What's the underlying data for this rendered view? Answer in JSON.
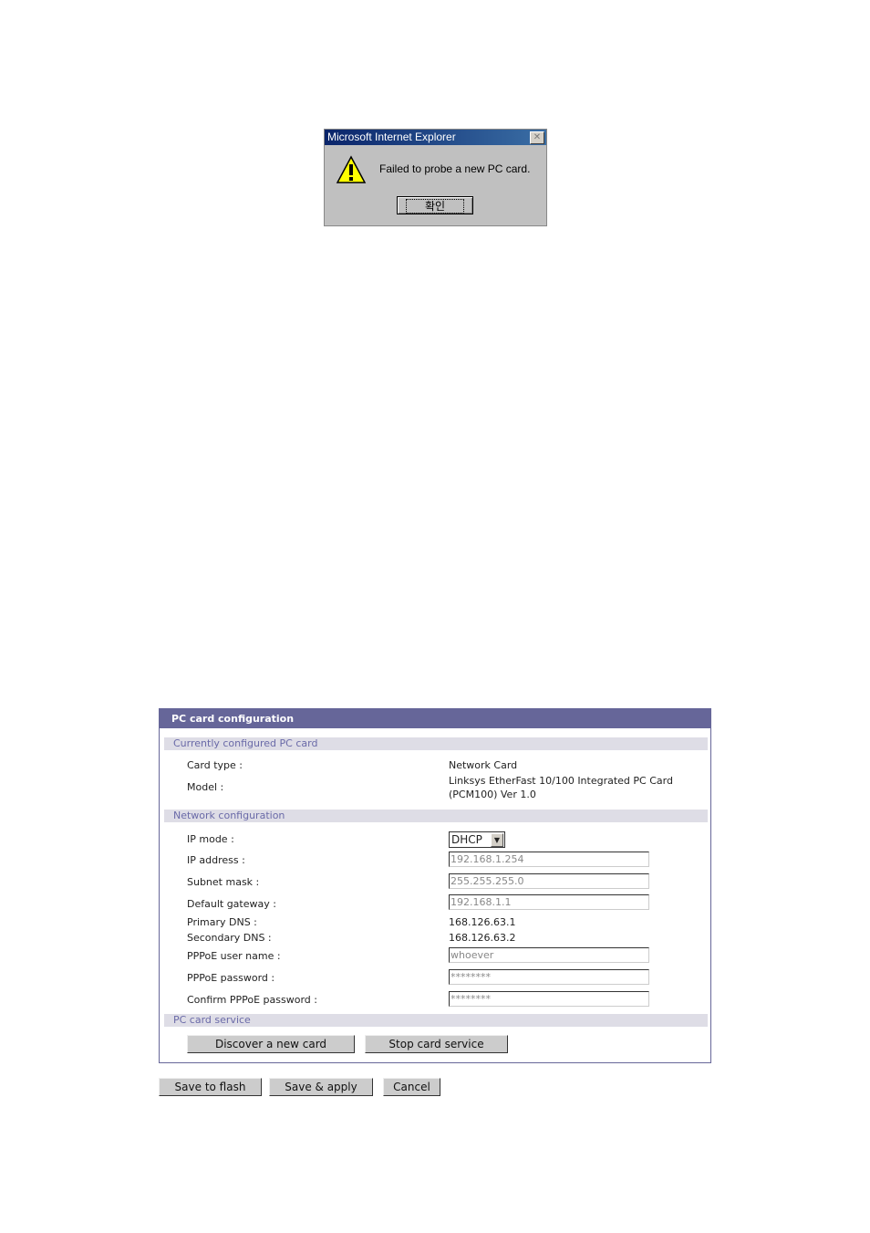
{
  "dialog": {
    "title": "Microsoft Internet Explorer",
    "icon": "warning-icon",
    "message": "Failed to probe a new PC card.",
    "ok_label": "확인",
    "close_glyph": "✕"
  },
  "panel": {
    "title": "PC card configuration",
    "sections": {
      "current": "Currently configured PC card",
      "network": "Network configuration",
      "service": "PC card service"
    },
    "card": {
      "type_label": "Card type :",
      "type_value": "Network Card",
      "model_label": "Model :",
      "model_line1": "Linksys EtherFast 10/100 Integrated PC Card",
      "model_line2": "(PCM100) Ver 1.0"
    },
    "network": {
      "ip_mode_label": "IP mode :",
      "ip_mode_value": "DHCP",
      "ip_label": "IP address :",
      "ip_value": "192.168.1.254",
      "mask_label": "Subnet mask :",
      "mask_value": "255.255.255.0",
      "gw_label": "Default gateway :",
      "gw_value": "192.168.1.1",
      "dns1_label": "Primary DNS :",
      "dns1_value": "168.126.63.1",
      "dns2_label": "Secondary DNS :",
      "dns2_value": "168.126.63.2",
      "pppoe_user_label": "PPPoE user name :",
      "pppoe_user_value": "whoever",
      "pppoe_pw_label": "PPPoE password :",
      "pppoe_pw_value": "********",
      "pppoe_confirm_label": "Confirm PPPoE password :",
      "pppoe_confirm_value": "********"
    },
    "service": {
      "discover_label": "Discover a new card",
      "stop_label": "Stop card service"
    }
  },
  "footer": {
    "save_flash": "Save to flash",
    "save_apply": "Save & apply",
    "cancel": "Cancel"
  }
}
